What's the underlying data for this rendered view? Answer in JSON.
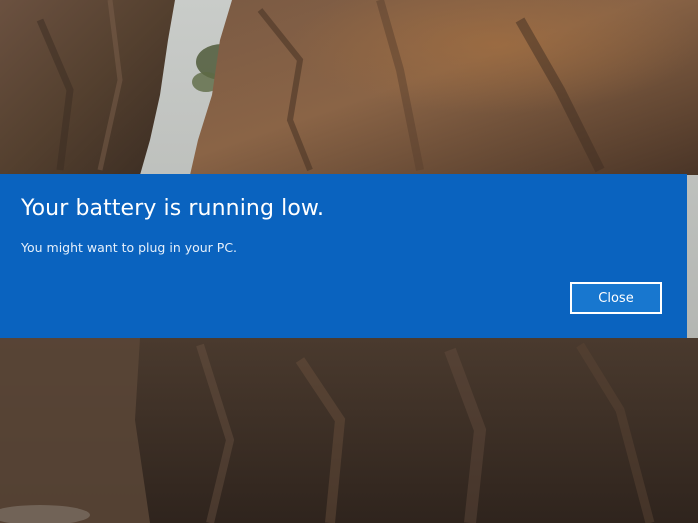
{
  "notification": {
    "title": "Your battery is running low.",
    "message": "You might want to plug in your PC.",
    "close_label": "Close"
  },
  "colors": {
    "dialog_background": "#0a63bf",
    "button_background": "#1877cf",
    "text": "#ffffff"
  }
}
